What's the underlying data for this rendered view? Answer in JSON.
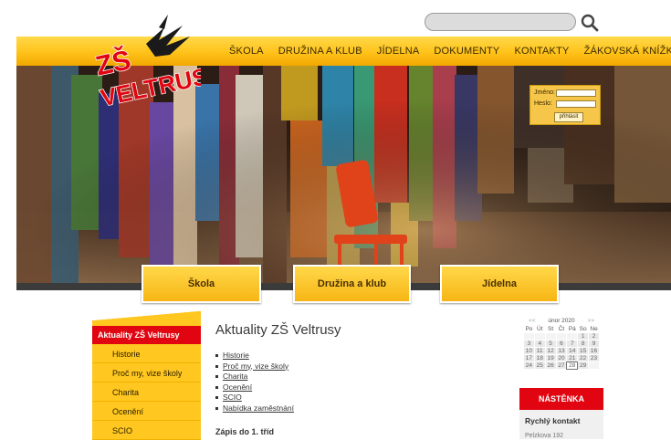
{
  "logo": {
    "line1": "ZŠ",
    "line2": "VELTRUSY"
  },
  "search": {
    "placeholder": ""
  },
  "nav": [
    "ŠKOLA",
    "DRUŽINA A KLUB",
    "JÍDELNA",
    "DOKUMENTY",
    "KONTAKTY",
    "ŽÁKOVSKÁ KNÍŽKA"
  ],
  "login": {
    "user_label": "Jméno:",
    "pass_label": "Heslo:",
    "submit": "přihlásit"
  },
  "bigtabs": [
    "Škola",
    "Družina a klub",
    "Jídelna"
  ],
  "sidebar": {
    "header": "Aktuality ZŠ Veltrusy",
    "items": [
      "Historie",
      "Proč my, vize školy",
      "Charita",
      "Ocenění",
      "SCIO"
    ]
  },
  "main": {
    "title": "Aktuality ZŠ Veltrusy",
    "links": [
      "Historie",
      "Proč my, vize školy",
      "Charita",
      "Ocenění",
      "SCIO",
      "Nabídka zaměstnání"
    ],
    "subhead": "Zápis do 1. tříd"
  },
  "calendar": {
    "prev": "<<",
    "next": ">>",
    "month": "únor 2020",
    "weekdays": [
      "Po",
      "Út",
      "St",
      "Čt",
      "Pá",
      "So",
      "Ne"
    ],
    "weeks": [
      [
        "",
        "",
        "",
        "",
        "",
        "1",
        "2"
      ],
      [
        "3",
        "4",
        "5",
        "6",
        "7",
        "8",
        "9"
      ],
      [
        "10",
        "11",
        "12",
        "13",
        "14",
        "15",
        "16"
      ],
      [
        "17",
        "18",
        "19",
        "20",
        "21",
        "22",
        "23"
      ],
      [
        "24",
        "25",
        "26",
        "27",
        "28",
        "29",
        ""
      ]
    ],
    "today": "28"
  },
  "notice": {
    "title": "NÁSTĚNKA",
    "quick": "Rychlý kontakt",
    "line": "Pelzkova 192"
  },
  "colors": {
    "nav_yellow": "#ffc21a",
    "accent_red": "#e00510",
    "sidebar_yellow": "#ffc71f"
  }
}
